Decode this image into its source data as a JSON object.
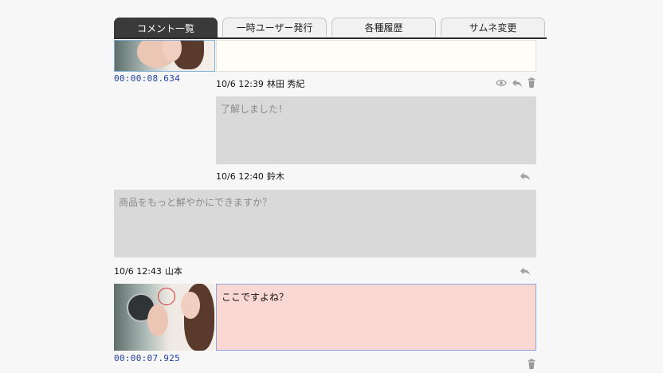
{
  "tabs": [
    {
      "label": "コメント一覧",
      "active": true
    },
    {
      "label": "一時ユーザー発行",
      "active": false
    },
    {
      "label": "各種履歴",
      "active": false
    },
    {
      "label": "サムネ変更",
      "active": false
    }
  ],
  "comments": [
    {
      "timecode": "00:00:08.634"
    },
    {
      "date": "10/6 12:39",
      "author": "林田 秀紀",
      "text": "了解しました！"
    },
    {
      "date": "10/6 12:40",
      "author": "鈴木",
      "text": ""
    },
    {
      "text": "商品をもっと鮮やかにできますか？"
    },
    {
      "date": "10/6 12:43",
      "author": "山本",
      "text": "ここですよね？",
      "timecode": "00:00:07.925"
    }
  ],
  "colors": {
    "accent_timecode": "#1f3fa8",
    "active_tab": "#3a3a3a",
    "highlight_box": "#f9d7d2",
    "marker": "#d8332e"
  },
  "icons": [
    "eye-icon",
    "reply-icon",
    "trash-icon"
  ]
}
